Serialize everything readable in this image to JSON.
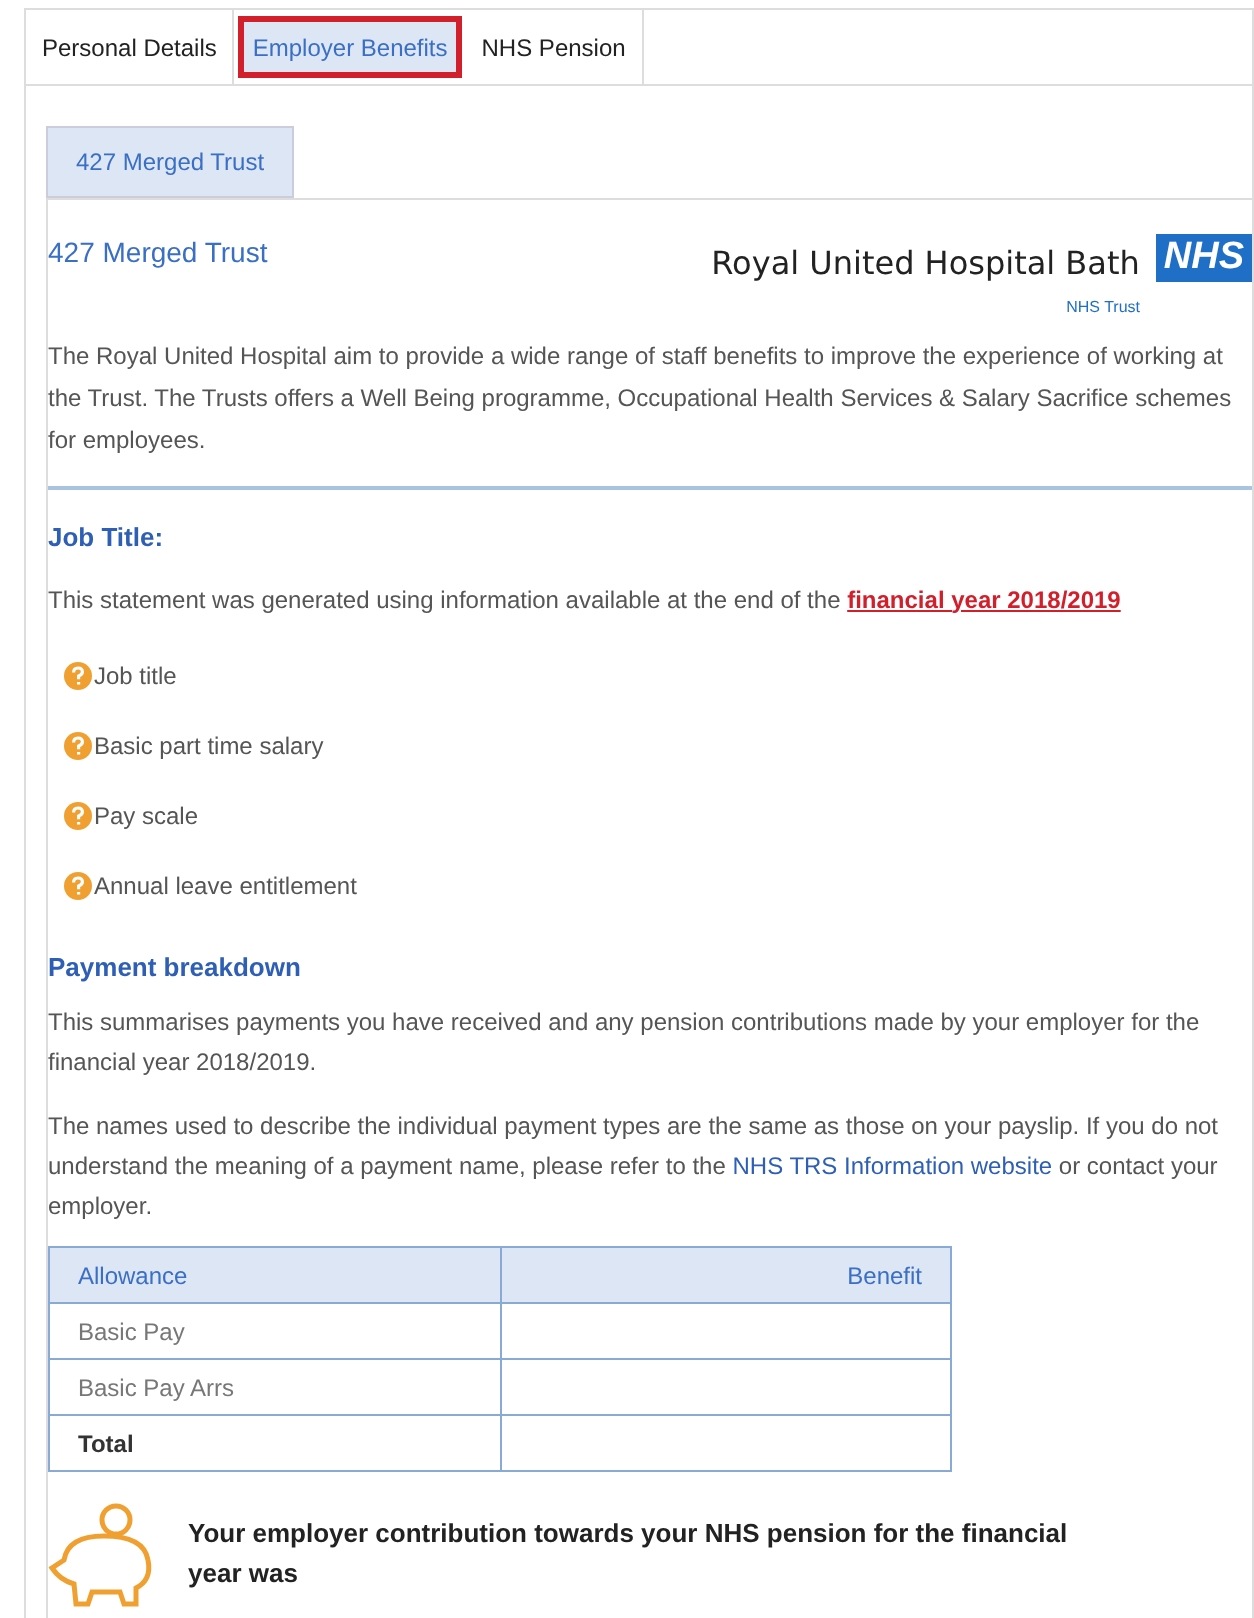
{
  "tabs": [
    {
      "label": "Personal Details",
      "selected": false
    },
    {
      "label": "Employer Benefits",
      "selected": true
    },
    {
      "label": "NHS Pension",
      "selected": false
    }
  ],
  "inner_tabs": [
    {
      "label": "427 Merged Trust",
      "selected": true
    }
  ],
  "header": {
    "title": "427 Merged Trust",
    "org_name": "Royal United Hospital Bath",
    "logo_text": "NHS",
    "org_subtitle": "NHS Trust"
  },
  "intro": "The Royal United Hospital aim to provide a wide range of staff benefits to improve the experience of working at the Trust. The Trusts offers a Well Being programme, Occupational Health Services & Salary Sacrifice schemes for employees.",
  "job_section": {
    "heading": "Job Title:",
    "statement": "This statement was generated using information available at the end of the",
    "statement_link": "financial year 2018/2019",
    "items": [
      "Job title",
      "Basic part time salary",
      "Pay scale",
      "Annual leave entitlement"
    ]
  },
  "payment_section": {
    "heading": "Payment breakdown",
    "paragraph_1": "This summarises payments you have received and any pension contributions made by your employer for the financial year 2018/2019.",
    "paragraph_2": "The names used to describe the individual payment types are the same as those on your payslip. If you do not understand the meaning of a payment name, please refer to the",
    "paragraph_2_link": "NHS TRS Information website",
    "paragraph_2_end": "or contact your employer."
  },
  "table": {
    "columns": [
      "Allowance",
      "Benefit"
    ],
    "rows": [
      {
        "label": "Basic Pay",
        "kind": "item"
      },
      {
        "label": "Basic Pay Arrs",
        "kind": "item"
      },
      {
        "label": "Total",
        "kind": "total"
      }
    ]
  },
  "pension_note": "Your employer contribution towards your NHS pension for the financial year was"
}
